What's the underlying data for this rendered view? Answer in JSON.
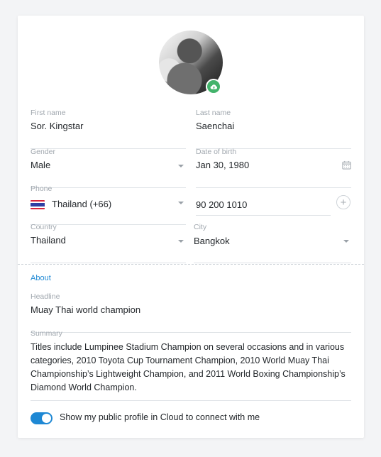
{
  "profile": {
    "avatar_alt": "Profile photo"
  },
  "fields": {
    "first_name": {
      "label": "First name",
      "value": "Sor. Kingstar"
    },
    "last_name": {
      "label": "Last name",
      "value": "Saenchai"
    },
    "gender": {
      "label": "Gender",
      "value": "Male"
    },
    "date_of_birth": {
      "label": "Date of birth",
      "value": "Jan 30, 1980"
    },
    "phone": {
      "label": "Phone",
      "country_code": "Thailand (+66)",
      "number": "90 200 1010"
    },
    "country": {
      "label": "Country",
      "value": "Thailand"
    },
    "city": {
      "label": "City",
      "value": "Bangkok"
    }
  },
  "about": {
    "section_title": "About",
    "headline": {
      "label": "Headline",
      "value": "Muay Thai world champion"
    },
    "summary": {
      "label": "Summary",
      "value": "Titles include Lumpinee Stadium Champion on several occasions and in various categories, 2010 Toyota Cup Tournament Champion, 2010 World Muay Thai Championship’s Lightweight Champion, and 2011 World Boxing Championship’s Diamond World Champion."
    }
  },
  "public_profile_toggle": {
    "label": "Show my public profile in Cloud to connect with me",
    "enabled": true
  },
  "colors": {
    "accent": "#1e88d4",
    "upload_badge": "#43b36b",
    "divider": "#dfe3e7"
  }
}
